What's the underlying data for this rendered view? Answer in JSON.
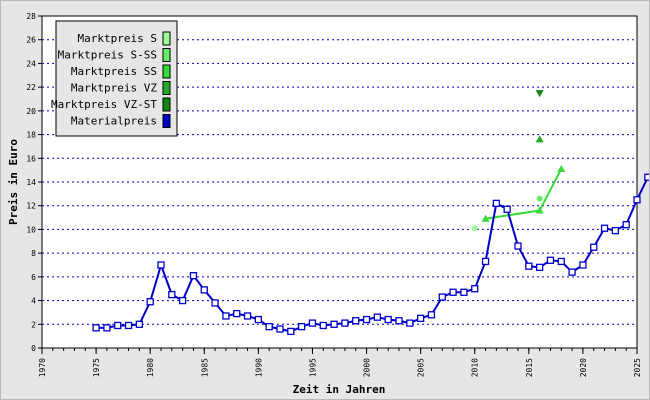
{
  "chart_data": {
    "type": "line",
    "xlabel": "Zeit in Jahren",
    "ylabel": "Preis in Euro",
    "xlim": [
      1970,
      2025
    ],
    "ylim": [
      0,
      28
    ],
    "x_ticks": [
      1970,
      1975,
      1980,
      1985,
      1990,
      1995,
      2000,
      2005,
      2010,
      2015,
      2020,
      2025
    ],
    "y_ticks": [
      0,
      2,
      4,
      6,
      8,
      10,
      12,
      14,
      16,
      18,
      20,
      22,
      24,
      26,
      28
    ],
    "grid": "horizontal-dotted",
    "legend_position": "top-left",
    "series": [
      {
        "name": "Marktpreis S",
        "color": "#99ff99",
        "marker": "circle",
        "points": [
          [
            2010,
            10.1
          ]
        ]
      },
      {
        "name": "Marktpreis S-SS",
        "color": "#66ee66",
        "marker": "circle",
        "points": [
          [
            2016,
            12.6
          ]
        ]
      },
      {
        "name": "Marktpreis SS",
        "color": "#33dd33",
        "marker": "triangle-up",
        "points": [
          [
            2011,
            10.9
          ],
          [
            2016,
            11.6
          ],
          [
            2018,
            15.1
          ]
        ]
      },
      {
        "name": "Marktpreis VZ",
        "color": "#22aa22",
        "marker": "triangle-up",
        "points": [
          [
            2016,
            17.6
          ]
        ]
      },
      {
        "name": "Marktpreis VZ-ST",
        "color": "#118811",
        "marker": "triangle-down",
        "points": [
          [
            2016,
            21.5
          ]
        ]
      },
      {
        "name": "Materialpreis",
        "color": "#0000cc",
        "marker": "square",
        "points": [
          [
            1975,
            1.7
          ],
          [
            1976,
            1.7
          ],
          [
            1977,
            1.9
          ],
          [
            1978,
            1.9
          ],
          [
            1979,
            2.0
          ],
          [
            1980,
            3.9
          ],
          [
            1981,
            7.0
          ],
          [
            1982,
            4.5
          ],
          [
            1983,
            4.0
          ],
          [
            1984,
            6.1
          ],
          [
            1985,
            4.9
          ],
          [
            1986,
            3.8
          ],
          [
            1987,
            2.7
          ],
          [
            1988,
            2.9
          ],
          [
            1989,
            2.7
          ],
          [
            1990,
            2.4
          ],
          [
            1991,
            1.8
          ],
          [
            1992,
            1.6
          ],
          [
            1993,
            1.4
          ],
          [
            1994,
            1.8
          ],
          [
            1995,
            2.1
          ],
          [
            1996,
            1.9
          ],
          [
            1997,
            2.0
          ],
          [
            1998,
            2.1
          ],
          [
            1999,
            2.3
          ],
          [
            2000,
            2.4
          ],
          [
            2001,
            2.6
          ],
          [
            2002,
            2.4
          ],
          [
            2003,
            2.3
          ],
          [
            2004,
            2.1
          ],
          [
            2005,
            2.5
          ],
          [
            2006,
            2.8
          ],
          [
            2007,
            4.3
          ],
          [
            2008,
            4.7
          ],
          [
            2009,
            4.7
          ],
          [
            2010,
            5.0
          ],
          [
            2011,
            7.3
          ],
          [
            2012,
            12.2
          ],
          [
            2013,
            11.7
          ],
          [
            2014,
            8.6
          ],
          [
            2015,
            6.9
          ],
          [
            2016,
            6.8
          ],
          [
            2017,
            7.4
          ],
          [
            2018,
            7.3
          ],
          [
            2019,
            6.4
          ],
          [
            2020,
            7.0
          ],
          [
            2021,
            8.5
          ],
          [
            2022,
            10.1
          ],
          [
            2023,
            9.9
          ],
          [
            2024,
            10.4
          ],
          [
            2025,
            12.5
          ],
          [
            2026,
            14.4
          ]
        ]
      }
    ]
  }
}
